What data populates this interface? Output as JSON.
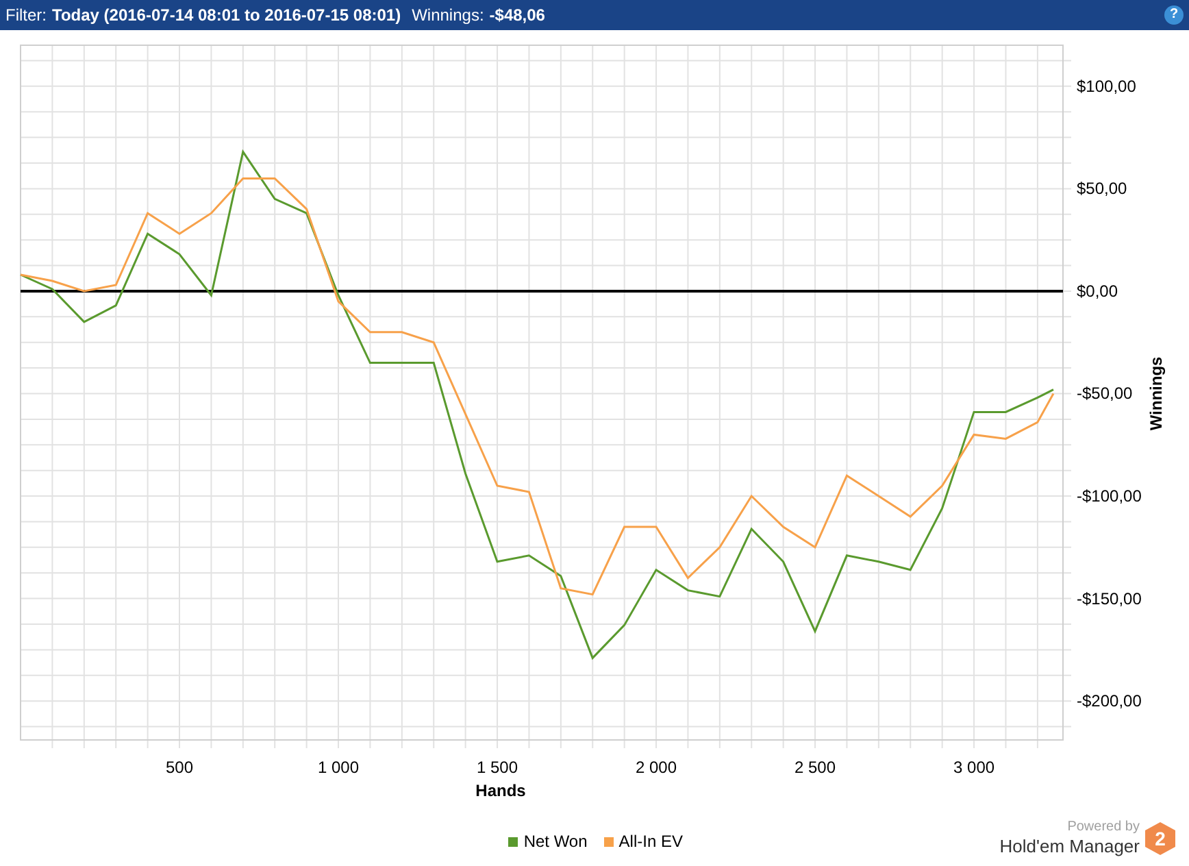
{
  "filter_bar": {
    "label": "Filter:",
    "filter": "Today (2016-07-14 08:01 to 2016-07-15 08:01)",
    "winnings_label": "Winnings:",
    "winnings": "-$48,06",
    "help": "?"
  },
  "chart": {
    "chart_data": {
      "type": "line",
      "grid": true,
      "xlabel": "Hands",
      "ylabel": "Winnings",
      "xlim": [
        0,
        3280
      ],
      "ylim": [
        -219,
        120
      ],
      "x": [
        0,
        100,
        200,
        300,
        400,
        500,
        600,
        700,
        800,
        900,
        1000,
        1100,
        1200,
        1300,
        1400,
        1500,
        1600,
        1700,
        1800,
        1900,
        2000,
        2100,
        2200,
        2300,
        2400,
        2500,
        2600,
        2700,
        2800,
        2900,
        3000,
        3100,
        3200,
        3250
      ],
      "series": [
        {
          "name": "Net Won",
          "color": "#5a9a2e",
          "values": [
            8,
            1,
            -15,
            -7,
            28,
            18,
            -2,
            68,
            45,
            38,
            -2,
            -35,
            -35,
            -35,
            -89,
            -132,
            -129,
            -139,
            -179,
            -163,
            -136,
            -146,
            -149,
            -116,
            -132,
            -166,
            -129,
            -132,
            -136,
            -106,
            -59,
            -59,
            -52,
            -48
          ]
        },
        {
          "name": "All-In EV",
          "color": "#f7a14a",
          "values": [
            8,
            5,
            0,
            3,
            38,
            28,
            38,
            55,
            55,
            40,
            -5,
            -20,
            -20,
            -25,
            -60,
            -95,
            -98,
            -145,
            -148,
            -115,
            -115,
            -140,
            -125,
            -100,
            -115,
            -125,
            -90,
            -100,
            -110,
            -95,
            -70,
            -72,
            -64,
            -50
          ]
        }
      ],
      "xticks": [
        {
          "value": 500,
          "label": "500"
        },
        {
          "value": 1000,
          "label": "1 000"
        },
        {
          "value": 1500,
          "label": "1 500"
        },
        {
          "value": 2000,
          "label": "2 000"
        },
        {
          "value": 2500,
          "label": "2 500"
        },
        {
          "value": 3000,
          "label": "3 000"
        }
      ],
      "yticks": [
        {
          "value": 100,
          "label": "$100,00"
        },
        {
          "value": 50,
          "label": "$50,00"
        },
        {
          "value": 0,
          "label": "$0,00"
        },
        {
          "value": -50,
          "label": "-$50,00"
        },
        {
          "value": -100,
          "label": "-$100,00"
        },
        {
          "value": -150,
          "label": "-$150,00"
        },
        {
          "value": -200,
          "label": "-$200,00"
        }
      ]
    }
  },
  "branding": {
    "powered_by": "Powered by",
    "product": "Hold'em Manager",
    "logo_mark": "2"
  }
}
